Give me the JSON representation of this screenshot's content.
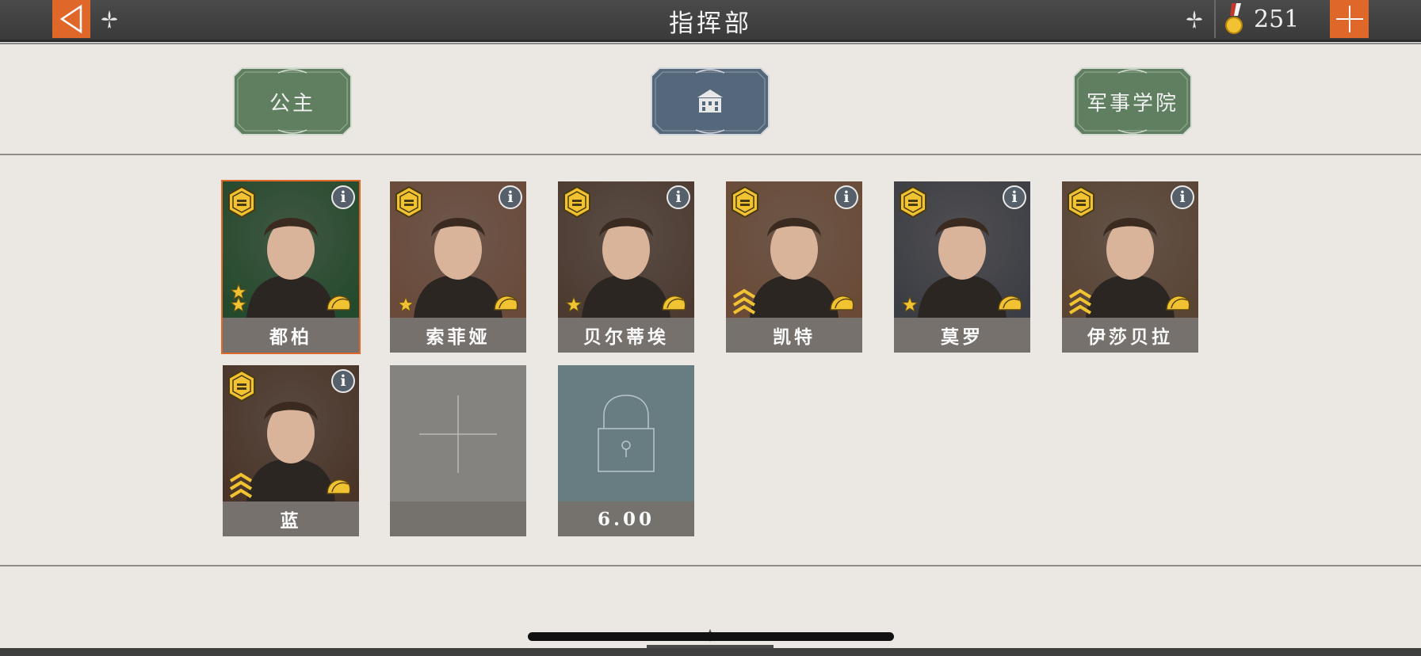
{
  "header": {
    "title": "指挥部",
    "medal_count": "251"
  },
  "tabs": [
    {
      "label": "公主",
      "color": "#5f7f60"
    },
    {
      "label": "",
      "icon": "building-icon",
      "color": "#55677a"
    },
    {
      "label": "军事学院",
      "color": "#5f7f60"
    }
  ],
  "cards": [
    {
      "name": "都柏",
      "stars": 2,
      "selected": true,
      "bg": "#234a2c"
    },
    {
      "name": "索菲娅",
      "stars": 1,
      "bg": "#6a4a3a"
    },
    {
      "name": "贝尔蒂埃",
      "stars": 1,
      "bg": "#4c3a30"
    },
    {
      "name": "凯特",
      "stars": 0,
      "bg": "#6a4a36"
    },
    {
      "name": "莫罗",
      "stars": 1,
      "bg": "#3b3d44"
    },
    {
      "name": "伊莎贝拉",
      "stars": 0,
      "bg": "#5a4434"
    },
    {
      "name": "蓝",
      "stars": 0,
      "bg": "#4a3428"
    }
  ],
  "empty_slot": {
    "label": ""
  },
  "locked_slot": {
    "price": "6.00"
  },
  "colors": {
    "accent": "#e0672a",
    "topbar": "#404040",
    "background": "#ebe8e3",
    "gold": "#f1c232"
  }
}
